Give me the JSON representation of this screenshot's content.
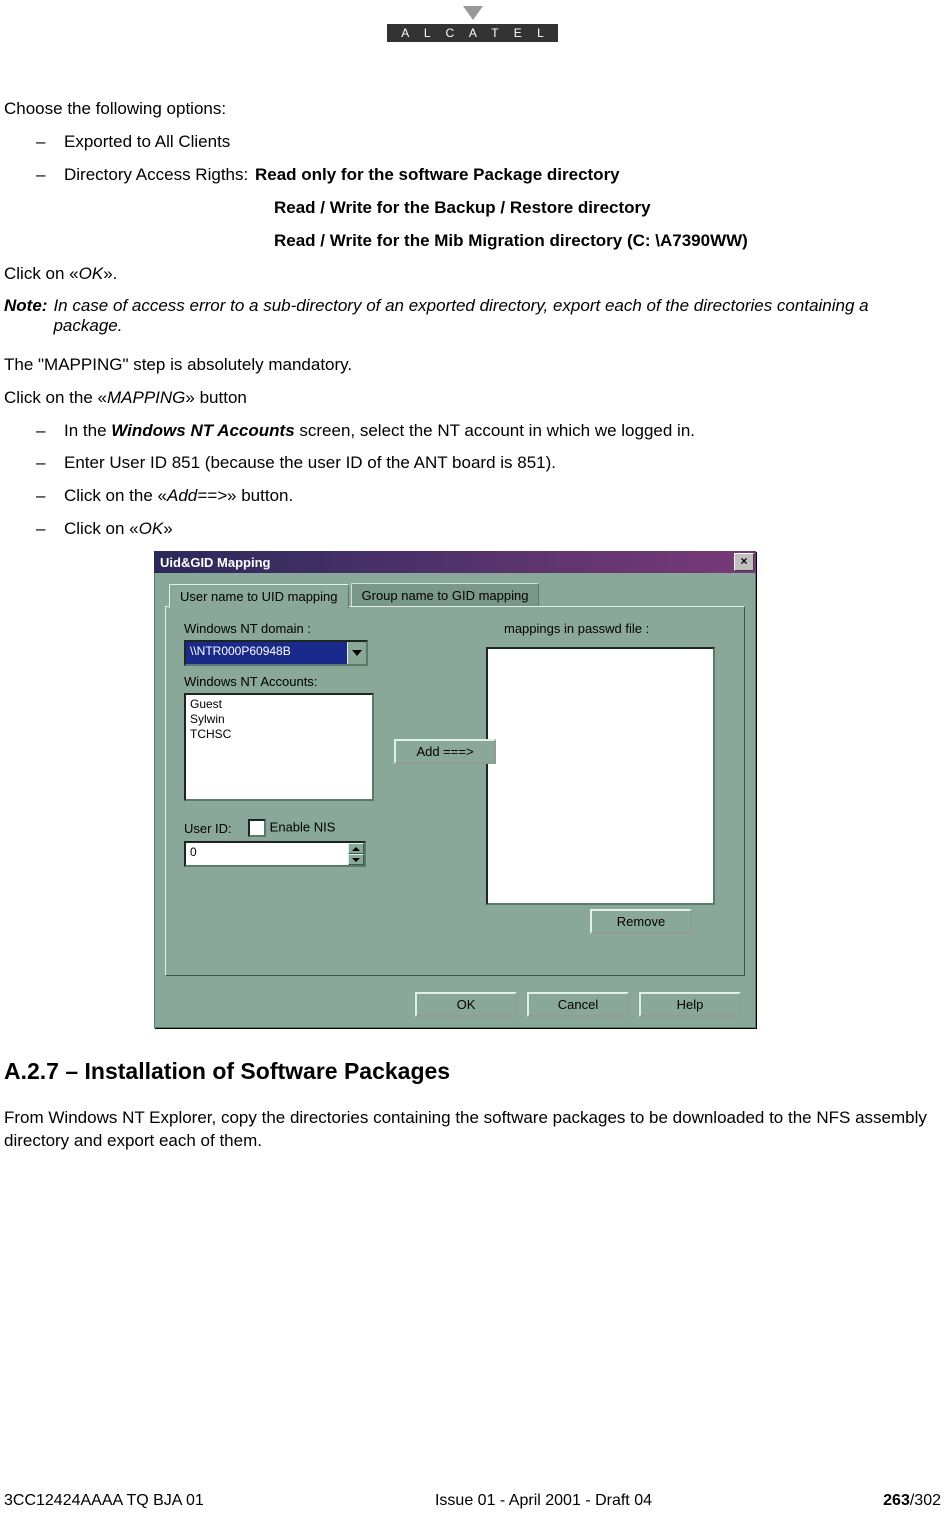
{
  "logo": "A L C A T E L",
  "intro": "Choose the following options:",
  "opt1": "Exported to All Clients",
  "opt2_label": "Directory Access Rigths:",
  "opt2_a": "Read only for the software Package directory",
  "opt2_b": "Read / Write for the Backup / Restore directory",
  "opt2_c": "Read / Write for the Mib Migration directory (C: \\A7390WW)",
  "click_ok_pre": "Click on «",
  "click_ok_ital": "OK",
  "click_ok_post": "».",
  "note_label": "Note:",
  "note_text": "In case of access error to a sub-directory of an exported directory, export each of the directories containing a package.",
  "mapping_mand": "The \"MAPPING\" step is absolutely mandatory.",
  "click_map_pre": "Click on the «",
  "click_map_ital": "MAPPING",
  "click_map_post": "» button",
  "step_a_pre": "In the ",
  "step_a_bold": "Windows NT Accounts",
  "step_a_post": " screen, select the NT account in which we logged in.",
  "step_b": "Enter User ID 851 (because the user ID of the ANT board is 851).",
  "step_c_pre": "Click on the «",
  "step_c_ital": "Add==>",
  "step_c_post": "» button.",
  "step_d_pre": "Click on «",
  "step_d_ital": "OK",
  "step_d_post": "»",
  "dialog": {
    "title": "Uid&GID Mapping",
    "tab_active": "User name to UID mapping",
    "tab_inactive": "Group name to GID mapping",
    "domain_label": "Windows NT domain :",
    "domain_value": "\\\\NTR000P60948B",
    "accounts_label": "Windows NT Accounts:",
    "accounts": {
      "a0": "Guest",
      "a1": "Sylwin",
      "a2": "TCHSC"
    },
    "mappings_label": "mappings in passwd file :",
    "add_btn": "Add  ===>",
    "userid_label": "User ID:",
    "enable_nis": "Enable NIS",
    "userid_value": "0",
    "remove_btn": "Remove",
    "ok_btn": "OK",
    "cancel_btn": "Cancel",
    "help_btn": "Help"
  },
  "section_head": "A.2.7 – Installation of Software Packages",
  "section_body": "From Windows NT Explorer, copy the directories containing the software packages to be downloaded to the NFS assembly directory and export each of them.",
  "footer": {
    "left": "3CC12424AAAA TQ BJA 01",
    "center": "Issue 01 - April 2001 - Draft 04",
    "page_bold": "263",
    "page_rest": "/302"
  }
}
